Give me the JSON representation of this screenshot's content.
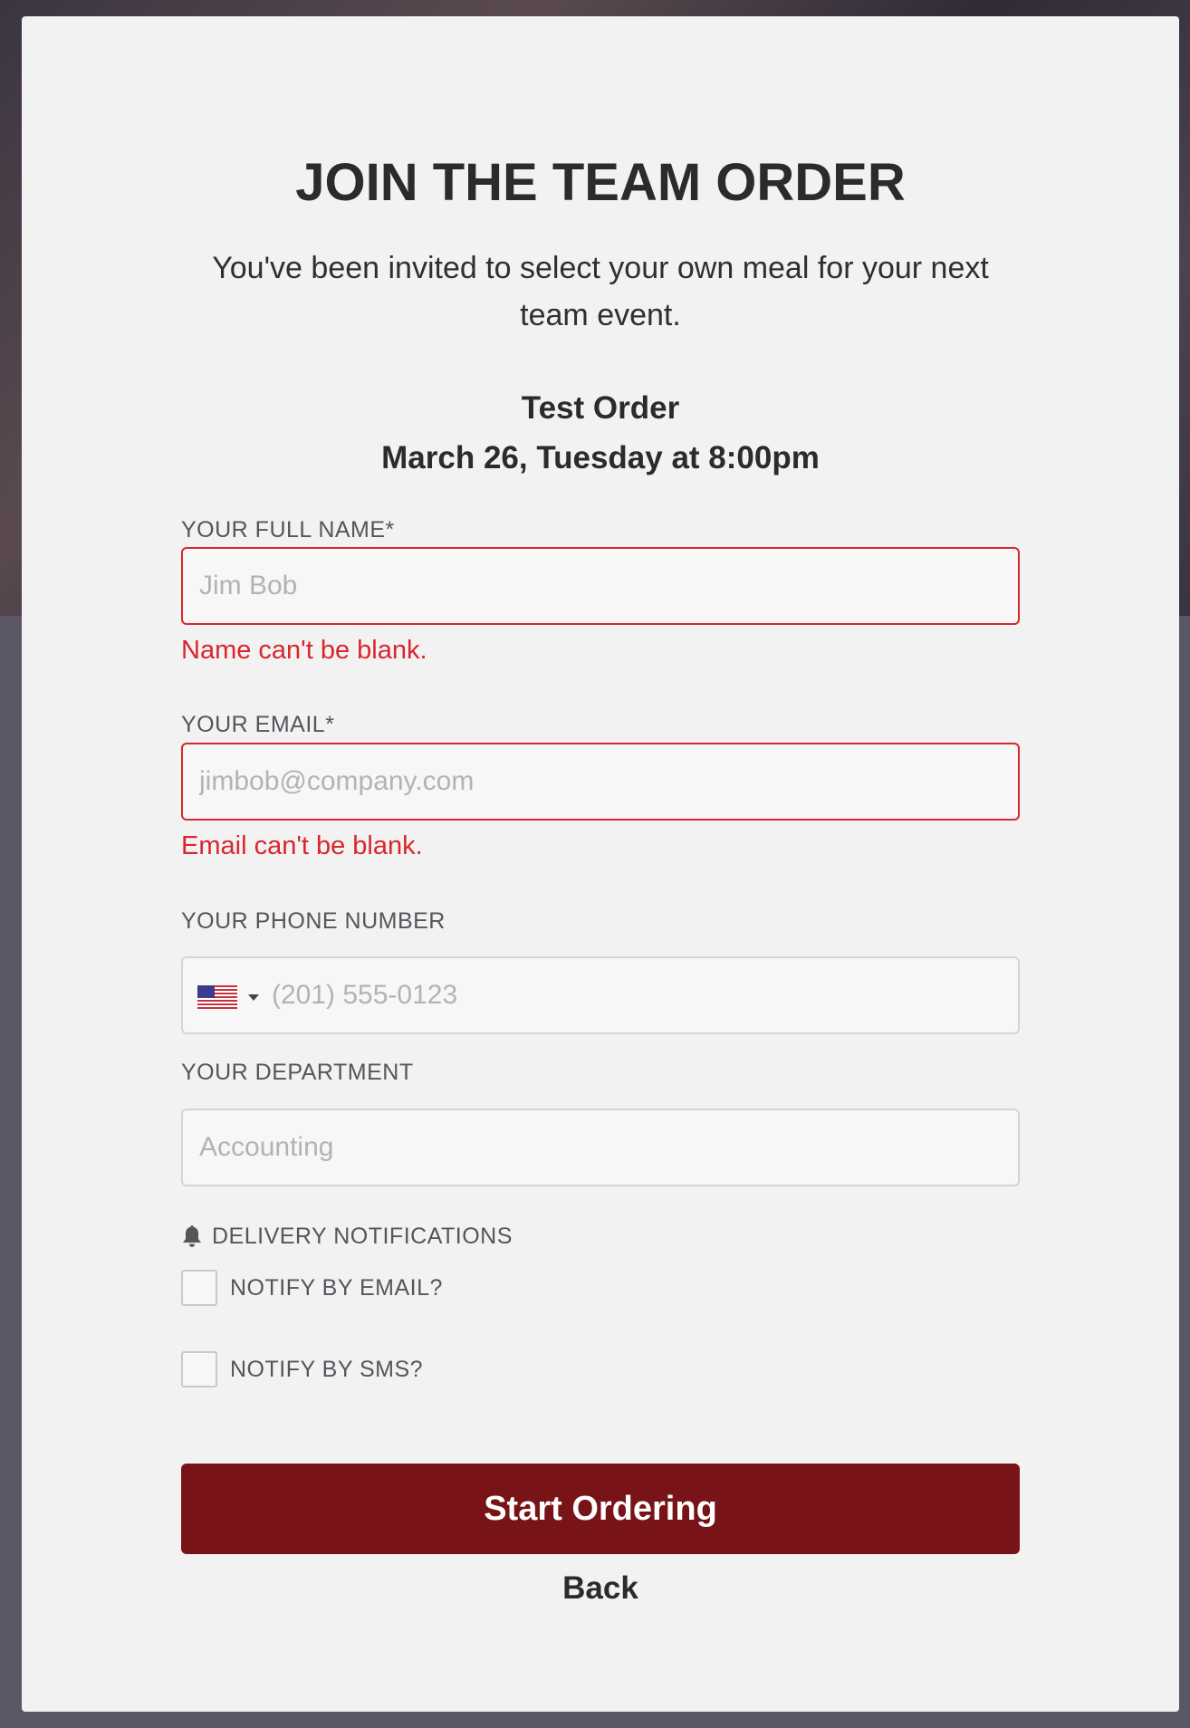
{
  "header": {
    "title": "JOIN THE TEAM ORDER",
    "subtitle": "You've been invited to select your own meal for your next team event."
  },
  "order": {
    "name": "Test Order",
    "datetime": "March 26, Tuesday at 8:00pm"
  },
  "form": {
    "full_name": {
      "label": "YOUR FULL NAME*",
      "placeholder": "Jim Bob",
      "value": "",
      "error": "Name can't be blank."
    },
    "email": {
      "label": "YOUR EMAIL*",
      "placeholder": "jimbob@company.com",
      "value": "",
      "error": "Email can't be blank."
    },
    "phone": {
      "label": "YOUR PHONE NUMBER",
      "placeholder": "(201) 555-0123",
      "value": "",
      "country_icon": "us-flag-icon"
    },
    "department": {
      "label": "YOUR DEPARTMENT",
      "placeholder": "Accounting",
      "value": ""
    }
  },
  "notifications": {
    "heading": "DELIVERY NOTIFICATIONS",
    "icon": "bell-icon",
    "email_label": "NOTIFY BY EMAIL?",
    "email_checked": false,
    "sms_label": "NOTIFY BY SMS?",
    "sms_checked": false
  },
  "actions": {
    "start_label": "Start Ordering",
    "back_label": "Back"
  },
  "colors": {
    "primary_button": "#781317",
    "error": "#d9262c",
    "modal_bg": "#f2f2f2"
  }
}
